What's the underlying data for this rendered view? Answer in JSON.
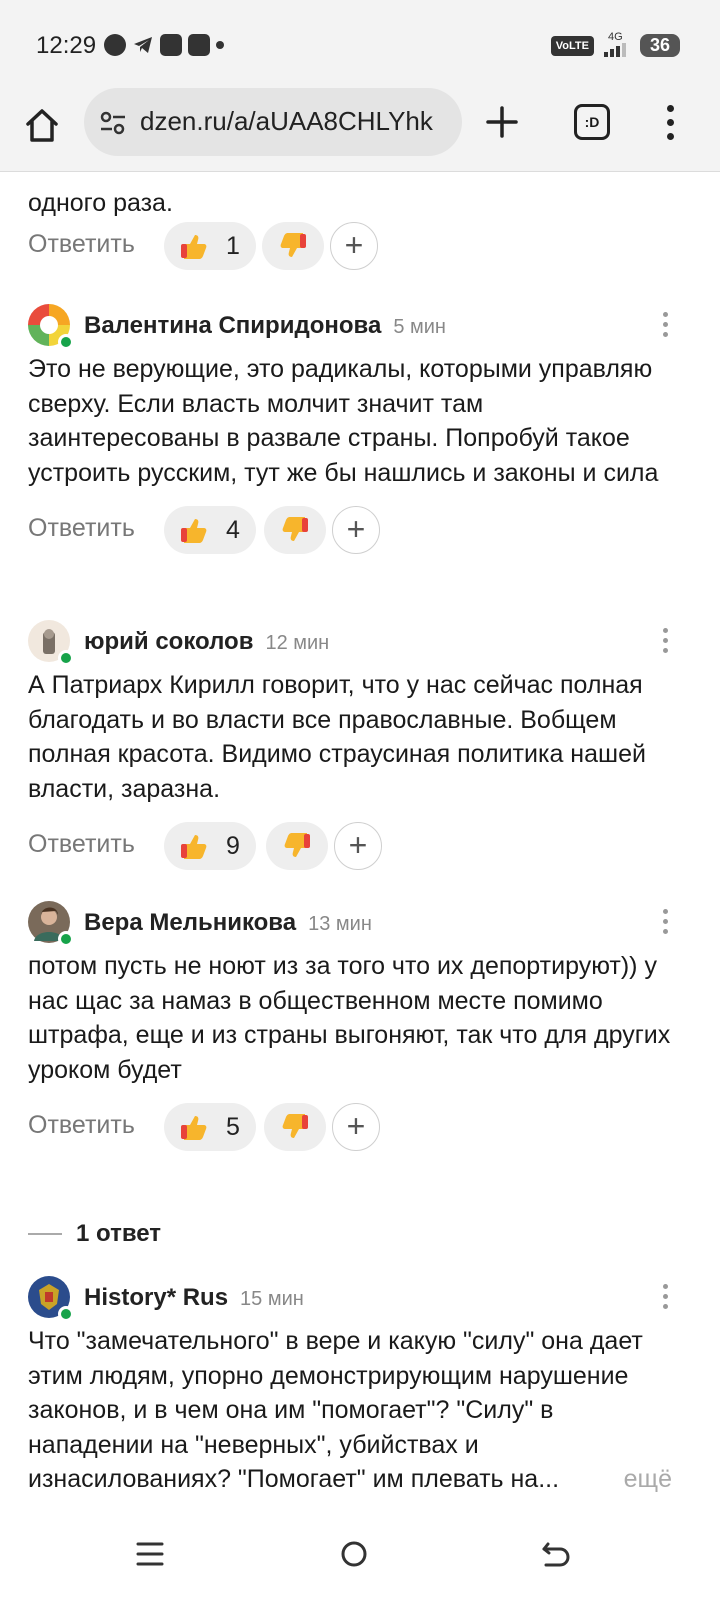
{
  "status_bar": {
    "time": "12:29",
    "network_label": "4G",
    "volte_label": "VoLTE",
    "battery": "36"
  },
  "browser": {
    "url": "dzen.ru/a/aUAA8CHLYhk",
    "tabs_label": ":D"
  },
  "partial_comment": {
    "text": "одного раза.",
    "reply_label": "Ответить",
    "likes": "1"
  },
  "comments": [
    {
      "author": "Валентина Спиридонова",
      "time": "5 мин",
      "text": "Это не верующие, это радикалы, которыми управляю сверху. Если власть молчит значит там заинтересованы в развале страны. Попробуй такое устроить русским, тут же бы нашлись и законы и сила",
      "reply_label": "Ответить",
      "likes": "4"
    },
    {
      "author": "юрий соколов",
      "time": "12 мин",
      "text": "А Патриарх Кирилл говорит, что у нас сейчас полная благодать и во власти все православные. Вобщем полная красота. Видимо страусиная политика нашей власти, заразна.",
      "reply_label": "Ответить",
      "likes": "9"
    },
    {
      "author": "Вера Мельникова",
      "time": "13 мин",
      "text": "потом пусть не ноют из за того что их депортируют)) у нас щас за намаз в общественном месте помимо штрафа, еще и из страны выгоняют, так что для других уроком будет",
      "reply_label": "Ответить",
      "likes": "5",
      "replies_label": "1 ответ"
    },
    {
      "author": "History* Rus",
      "time": "15 мин",
      "text": "Что \"замечательного\" в вере и какую \"силу\" она дает этим людям, упорно демонстрирующим нарушение законов, и в чем она им \"помогает\"? \"Силу\" в нападении на \"неверных\", убийствах и изнасилованиях? \"Помогает\" им плевать на...",
      "more_label": "ещё"
    }
  ],
  "colors": {
    "online": "#17a34a",
    "pill_bg": "#eeeeee",
    "muted": "#777777"
  }
}
